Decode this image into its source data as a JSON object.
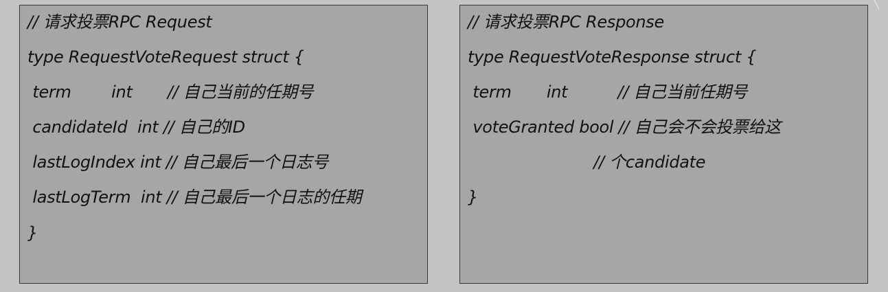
{
  "request_panel": {
    "line_1": "// 请求投票RPC Request",
    "line_2": "type RequestVoteRequest struct {",
    "line_3": " term        int       // 自己当前的任期号",
    "line_4": " candidateId  int // 自己的ID",
    "line_5": " lastLogIndex int // 自己最后一个日志号",
    "line_6": " lastLogTerm  int // 自己最后一个日志的任期",
    "line_7": "}"
  },
  "response_panel": {
    "line_1": "// 请求投票RPC Response",
    "line_2": "type RequestVoteResponse struct {",
    "line_3": " term       int          // 自己当前任期号",
    "line_4": " voteGranted bool // 自己会不会投票给这",
    "line_5": "                         // 个candidate",
    "line_6": "}"
  }
}
